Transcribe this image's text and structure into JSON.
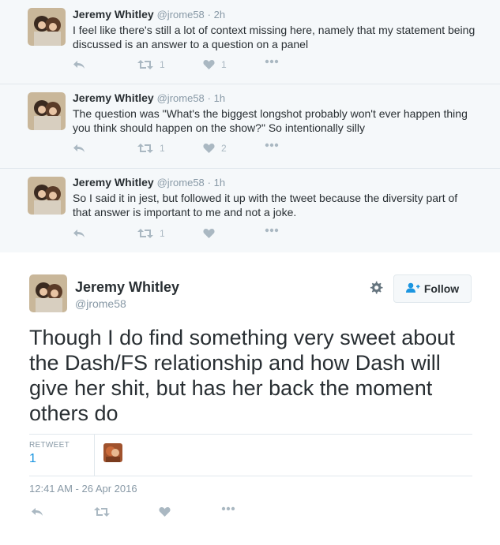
{
  "replies": [
    {
      "name": "Jeremy Whitley",
      "handle": "@jrome58",
      "time": "· 2h",
      "text": "I feel like there's still a lot of context missing here, namely that my statement being discussed is an answer to a question on a panel",
      "retweets": "1",
      "likes": "1"
    },
    {
      "name": "Jeremy Whitley",
      "handle": "@jrome58",
      "time": "· 1h",
      "text": "The question was \"What's the biggest longshot probably won't ever happen thing you think should happen on the show?\" So intentionally silly",
      "retweets": "1",
      "likes": "2"
    },
    {
      "name": "Jeremy Whitley",
      "handle": "@jrome58",
      "time": "· 1h",
      "text": "So I said it in jest, but followed it up with the tweet because the diversity part of that answer is important to me and not a joke.",
      "retweets": "1",
      "likes": ""
    }
  ],
  "main": {
    "name": "Jeremy Whitley",
    "handle": "@jrome58",
    "follow_label": "Follow",
    "text": "Though I do find something very sweet about the Dash/FS relationship and how Dash will give her shit, but has her back the moment others do",
    "retweet_label": "RETWEET",
    "retweet_count": "1",
    "timestamp": "12:41 AM - 26 Apr 2016"
  },
  "colors": {
    "accent": "#1b95e0",
    "muted": "#8899a6",
    "icon": "#aab8c2",
    "background_convo": "#f5f8fa"
  },
  "icons": [
    "reply-icon",
    "retweet-icon",
    "heart-icon",
    "more-icon",
    "gear-icon",
    "follow-user-icon"
  ]
}
